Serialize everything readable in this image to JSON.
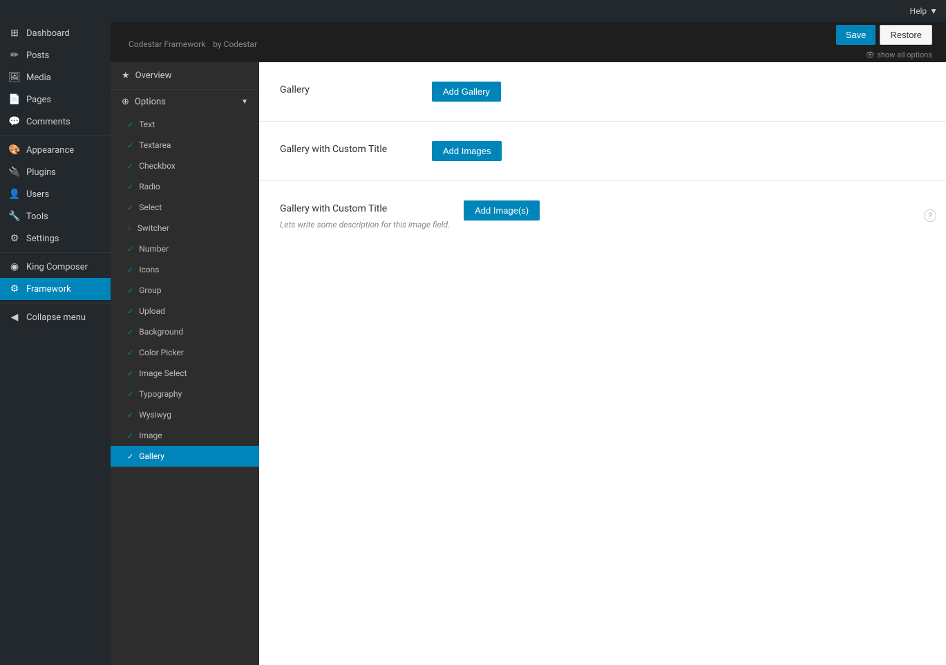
{
  "adminBar": {
    "helpLabel": "Help",
    "helpArrow": "▼"
  },
  "sidebar": {
    "items": [
      {
        "id": "dashboard",
        "label": "Dashboard",
        "icon": "⊞"
      },
      {
        "id": "posts",
        "label": "Posts",
        "icon": "✏"
      },
      {
        "id": "media",
        "label": "Media",
        "icon": "🖼"
      },
      {
        "id": "pages",
        "label": "Pages",
        "icon": "📄"
      },
      {
        "id": "comments",
        "label": "Comments",
        "icon": "💬"
      },
      {
        "id": "appearance",
        "label": "Appearance",
        "icon": "🎨"
      },
      {
        "id": "plugins",
        "label": "Plugins",
        "icon": "🔌"
      },
      {
        "id": "users",
        "label": "Users",
        "icon": "👤"
      },
      {
        "id": "tools",
        "label": "Tools",
        "icon": "🔧"
      },
      {
        "id": "settings",
        "label": "Settings",
        "icon": "⚙"
      },
      {
        "id": "king-composer",
        "label": "King Composer",
        "icon": "◉"
      },
      {
        "id": "framework",
        "label": "Framework",
        "icon": "⚙",
        "active": true
      },
      {
        "id": "collapse",
        "label": "Collapse menu",
        "icon": "◀"
      }
    ]
  },
  "header": {
    "title": "Codestar Framework",
    "subtitle": "by Codestar",
    "saveLabel": "Save",
    "restoreLabel": "Restore",
    "showAllOptions": "show all options"
  },
  "fwNav": {
    "overviewLabel": "Overview",
    "overviewIcon": "★",
    "optionsLabel": "Options",
    "optionsIcon": "⊕",
    "collapseIcon": "▼",
    "navItems": [
      {
        "id": "text",
        "label": "Text",
        "check": "✓"
      },
      {
        "id": "textarea",
        "label": "Textarea",
        "check": "✓"
      },
      {
        "id": "checkbox",
        "label": "Checkbox",
        "check": "✓"
      },
      {
        "id": "radio",
        "label": "Radio",
        "check": "✓"
      },
      {
        "id": "select",
        "label": "Select",
        "check": "✓"
      },
      {
        "id": "switcher",
        "label": "Switcher",
        "check": "○"
      },
      {
        "id": "number",
        "label": "Number",
        "check": "✓"
      },
      {
        "id": "icons",
        "label": "Icons",
        "check": "✓"
      },
      {
        "id": "group",
        "label": "Group",
        "check": "✓"
      },
      {
        "id": "upload",
        "label": "Upload",
        "check": "✓"
      },
      {
        "id": "background",
        "label": "Background",
        "check": "✓"
      },
      {
        "id": "color-picker",
        "label": "Color Picker",
        "check": "✓"
      },
      {
        "id": "image-select",
        "label": "Image Select",
        "check": "✓"
      },
      {
        "id": "typography",
        "label": "Typography",
        "check": "✓"
      },
      {
        "id": "wysiwyg",
        "label": "Wysiwyg",
        "check": "✓"
      },
      {
        "id": "image",
        "label": "Image",
        "check": "✓"
      },
      {
        "id": "gallery",
        "label": "Gallery",
        "check": "✓",
        "active": true
      }
    ]
  },
  "galleryItems": [
    {
      "id": "gallery-1",
      "label": "Gallery",
      "buttonLabel": "Add Gallery",
      "description": "",
      "hasHelp": false
    },
    {
      "id": "gallery-2",
      "label": "Gallery with Custom Title",
      "buttonLabel": "Add Images",
      "description": "",
      "hasHelp": false
    },
    {
      "id": "gallery-3",
      "label": "Gallery with Custom Title",
      "buttonLabel": "Add Image(s)",
      "description": "Lets write some description for this image field.",
      "hasHelp": true
    }
  ]
}
